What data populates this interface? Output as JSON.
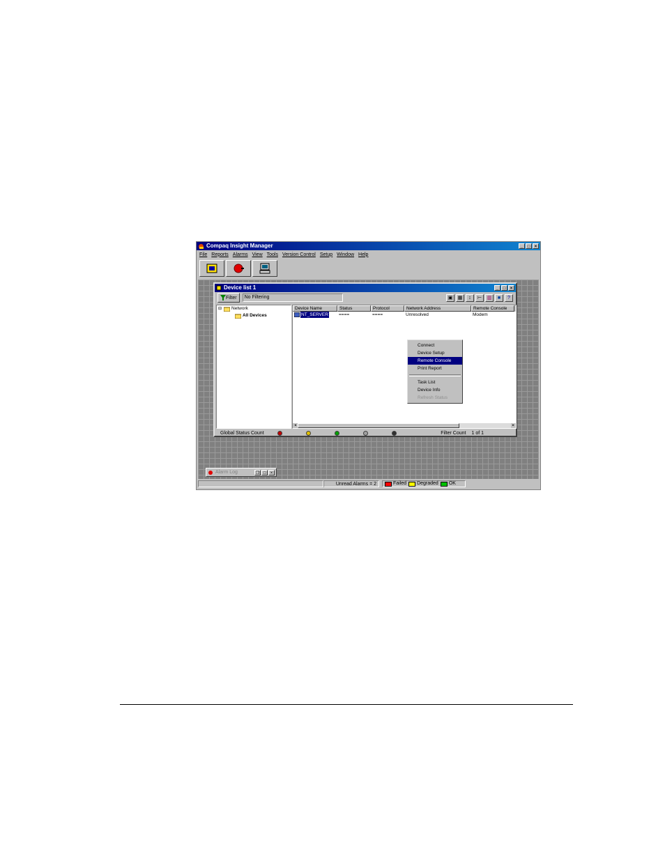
{
  "app": {
    "title": "Compaq Insight Manager",
    "menu": [
      "File",
      "Reports",
      "Alarms",
      "View",
      "Tools",
      "Version Control",
      "Setup",
      "Window",
      "Help"
    ],
    "toolbar_icons": [
      "device-list-icon",
      "alarm-icon",
      "computer-icon"
    ]
  },
  "device_window": {
    "title": "Device list 1",
    "filter_button": "Filter",
    "filter_value": "No Filtering",
    "toolbar_icons": [
      "folder-icon",
      "grid-icon",
      "sort-icon",
      "tree-icon",
      "bars-icon",
      "monitor-icon",
      "help-icon"
    ],
    "tree": {
      "root": "Network",
      "child": "All Devices"
    },
    "columns": [
      "Device Name",
      "Status",
      "Protocol",
      "Network Address",
      "Remote Console"
    ],
    "rows": [
      {
        "name": "NT_SERVER",
        "status": "====",
        "protocol": "====",
        "address": "Unresolved",
        "console": "Modem"
      }
    ],
    "status_label": "Global Status Count",
    "status_colors": [
      "#c00000",
      "#e0c000",
      "#00a000",
      "#a0a0a0",
      "#303030"
    ],
    "filter_count_label": "Filter Count",
    "filter_count_value": "1 of 1"
  },
  "context_menu": {
    "items": [
      "Connect",
      "Device Setup",
      "Remote Console",
      "Print Report"
    ],
    "items2": [
      "Task List",
      "Device Info",
      "Refresh Status"
    ],
    "selected": "Remote Console"
  },
  "alarm_log": {
    "title": "Alarm Log"
  },
  "statusbar": {
    "unread": "Unread Alarms = 2",
    "legend": [
      {
        "label": "Failed",
        "color": "#ff0000"
      },
      {
        "label": "Degraded",
        "color": "#ffff00"
      },
      {
        "label": "OK",
        "color": "#00c000"
      }
    ]
  }
}
